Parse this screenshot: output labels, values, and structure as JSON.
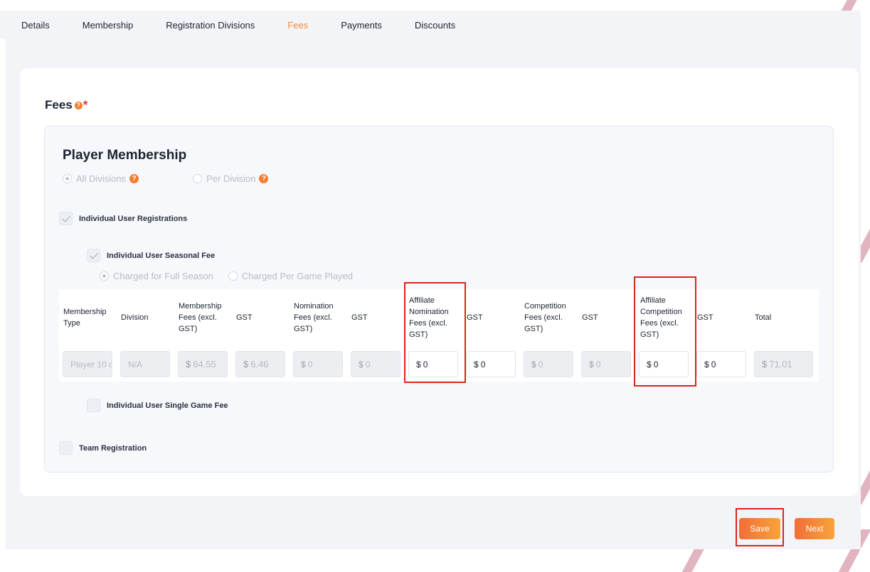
{
  "tabs": [
    {
      "label": "Details"
    },
    {
      "label": "Membership"
    },
    {
      "label": "Registration Divisions"
    },
    {
      "label": "Fees",
      "active": true
    },
    {
      "label": "Payments"
    },
    {
      "label": "Discounts"
    }
  ],
  "fees": {
    "title": "Fees",
    "help_glyph": "?",
    "required_mark": "*"
  },
  "player_membership": {
    "title": "Player Membership",
    "scope_options": [
      {
        "label": "All Divisions",
        "selected": true
      },
      {
        "label": "Per Division",
        "selected": false
      }
    ],
    "individual_user_registrations": {
      "label": "Individual User Registrations",
      "checked": true
    },
    "seasonal_fee": {
      "label": "Individual User Seasonal Fee",
      "checked": true
    },
    "charge_options": [
      {
        "label": "Charged for Full Season",
        "selected": true
      },
      {
        "label": "Charged Per Game Played",
        "selected": false
      }
    ],
    "single_game_fee": {
      "label": "Individual User Single Game Fee",
      "checked": false
    },
    "team_registration": {
      "label": "Team Registration",
      "checked": false
    }
  },
  "fee_table": {
    "headers": {
      "membership_type": "Membership Type",
      "division": "Division",
      "membership_fees": "Membership Fees (excl. GST)",
      "gst1": "GST",
      "nomination_fees": "Nomination Fees (excl. GST)",
      "gst2": "GST",
      "affiliate_nomination_fees": "Affiliate Nomination Fees (excl. GST)",
      "gst3": "GST",
      "competition_fees": "Competition Fees (excl. GST)",
      "gst4": "GST",
      "affiliate_competition_fees": "Affiliate Competition Fees (excl. GST)",
      "gst5": "GST",
      "total": "Total"
    },
    "row": {
      "membership_type": "Player 10 o",
      "division": "N/A",
      "currency": "$",
      "membership_fees": "64.55",
      "gst1": "6.46",
      "nomination_fees": "0",
      "gst2": "0",
      "affiliate_nomination_fees": "0",
      "gst3": "0",
      "competition_fees": "0",
      "gst4": "0",
      "affiliate_competition_fees": "0",
      "gst5": "0",
      "total": "71.01"
    }
  },
  "buttons": {
    "save": "Save",
    "next": "Next"
  },
  "colors": {
    "accent": "#f88a32",
    "highlight": "#d9261c",
    "page_bg": "#f3f4f8"
  }
}
